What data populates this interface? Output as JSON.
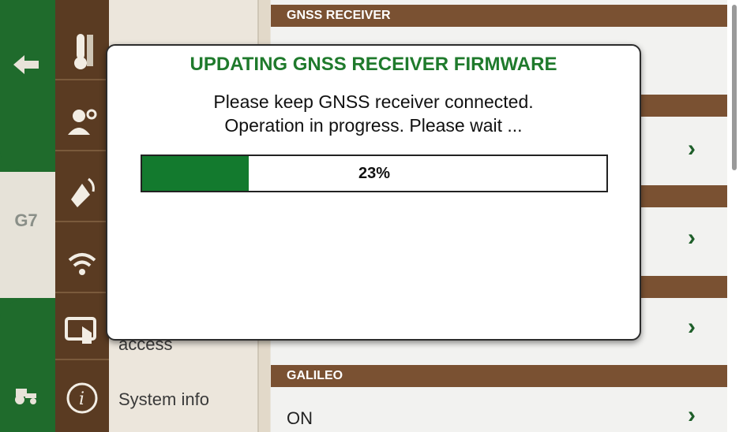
{
  "sidebar": {
    "menu": [
      {
        "icon": "thermometer-icon",
        "label": ""
      },
      {
        "icon": "user-settings-icon",
        "label": ""
      },
      {
        "icon": "gnss-antenna-icon",
        "label": ""
      },
      {
        "icon": "wifi-icon",
        "label": ""
      },
      {
        "icon": "touch-screen-icon",
        "label": "access"
      },
      {
        "icon": "info-icon",
        "label": "System info"
      }
    ]
  },
  "left_rail": {
    "back_icon": "back-arrow-icon",
    "brand": "G7",
    "tractor_icon": "tractor-icon"
  },
  "settings": {
    "sections": [
      {
        "title": "GNSS RECEIVER"
      },
      {
        "title": "GALILEO",
        "value": "ON"
      }
    ]
  },
  "dialog": {
    "title": "UPDATING GNSS RECEIVER FIRMWARE",
    "line1": "Please keep GNSS receiver connected.",
    "line2": "Operation in progress. Please wait ...",
    "progress_percent": 23,
    "progress_label": "23%"
  },
  "colors": {
    "accent_green": "#137a2e",
    "title_green": "#1f7a2c",
    "section_brown": "#7a5132"
  }
}
